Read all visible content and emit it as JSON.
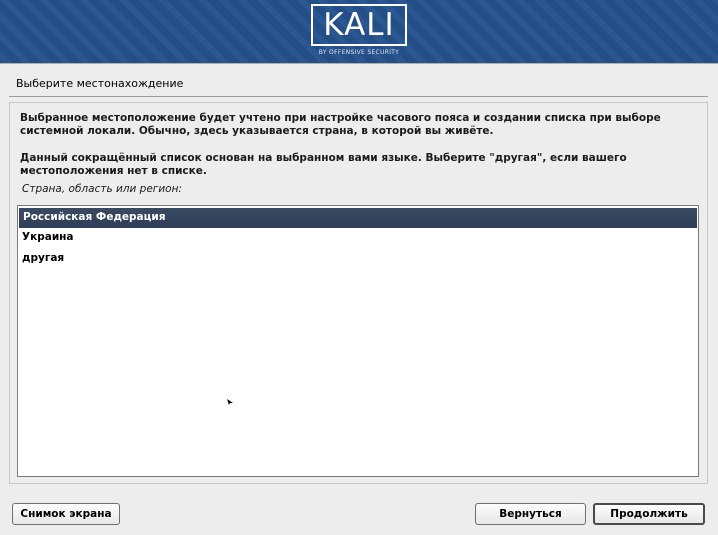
{
  "header": {
    "logo_text": "KALI",
    "logo_subtitle": "BY OFFENSIVE SECURITY"
  },
  "page": {
    "title": "Выберите местонахождение",
    "description_1": "Выбранное местоположение будет учтено при настройке часового пояса и создании списка при выборе системной локали. Обычно, здесь указывается страна, в которой вы живёте.",
    "description_2": "Данный сокращённый список основан на выбранном вами языке. Выберите \"другая\", если вашего местоположения нет в списке.",
    "list_label": "Страна, область или регион:"
  },
  "location_list": {
    "items": [
      {
        "label": "Российская Федерация",
        "selected": true
      },
      {
        "label": "Украина",
        "selected": false
      },
      {
        "label": "другая",
        "selected": false
      }
    ]
  },
  "buttons": {
    "screenshot": "Снимок экрана",
    "back": "Вернуться",
    "continue": "Продолжить"
  },
  "colors": {
    "banner": "#244f86",
    "selection": "#34445d",
    "background": "#ededed"
  },
  "icons": {
    "cursor": "mouse-pointer-icon"
  }
}
